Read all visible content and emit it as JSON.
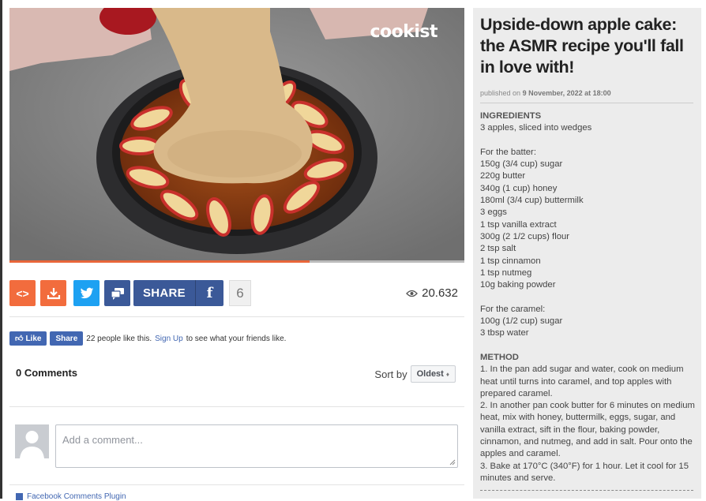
{
  "video": {
    "logo_text": "cookist",
    "progress_percent": 66
  },
  "toolbar": {
    "embed_icon": "code-icon",
    "download_icon": "download-icon",
    "twitter_icon": "twitter-icon",
    "comment_icon": "chat-icon",
    "share_label": "SHARE",
    "facebook_glyph": "f",
    "share_count": "6",
    "views_icon": "eye-icon",
    "views": "20.632",
    "colors": {
      "orange": "#f26c3d",
      "twitter": "#1da1f2",
      "facebook": "#3b5998"
    }
  },
  "facebook": {
    "like_label": "Like",
    "share_label": "Share",
    "likes_text": "22 people like this.",
    "signup_link": "Sign Up",
    "signup_suffix": "to see what your friends like."
  },
  "comments": {
    "count_label": "0 Comments",
    "sort_label": "Sort by",
    "sort_value": "Oldest",
    "placeholder": "Add a comment...",
    "plugin_label": "Facebook Comments Plugin"
  },
  "article": {
    "title": "Upside-down apple cake: the ASMR recipe you'll fall in love with!",
    "published_prefix": "published on",
    "published_date": "9 November, 2022 at 18:00",
    "ingredients_heading": "INGREDIENTS",
    "ingredients_main": [
      "3 apples, sliced into wedges"
    ],
    "batter_heading": "For the batter:",
    "batter": [
      "150g (3/4 cup) sugar",
      "220g butter",
      "340g (1 cup) honey",
      "180ml (3/4 cup) buttermilk",
      "3 eggs",
      "1 tsp vanilla extract",
      "300g (2 1/2 cups) flour",
      "2 tsp salt",
      "1 tsp cinnamon",
      "1 tsp nutmeg",
      "10g baking powder"
    ],
    "caramel_heading": "For the caramel:",
    "caramel": [
      "100g (1/2 cup) sugar",
      "3 tbsp water"
    ],
    "method_heading": "METHOD",
    "method": [
      "1. In the pan add sugar and water, cook on medium heat until turns into caramel, and top apples with prepared caramel.",
      "2. In another pan cook butter for 6 minutes on medium heat, mix with honey, buttermilk, eggs, sugar, and vanilla extract, sift in the flour, baking powder, cinnamon, and nutmeg, and add in salt. Pour onto the apples and caramel.",
      "3. Bake at 170°C (340°F) for 1 hour. Let it cool for 15 minutes and serve."
    ]
  }
}
